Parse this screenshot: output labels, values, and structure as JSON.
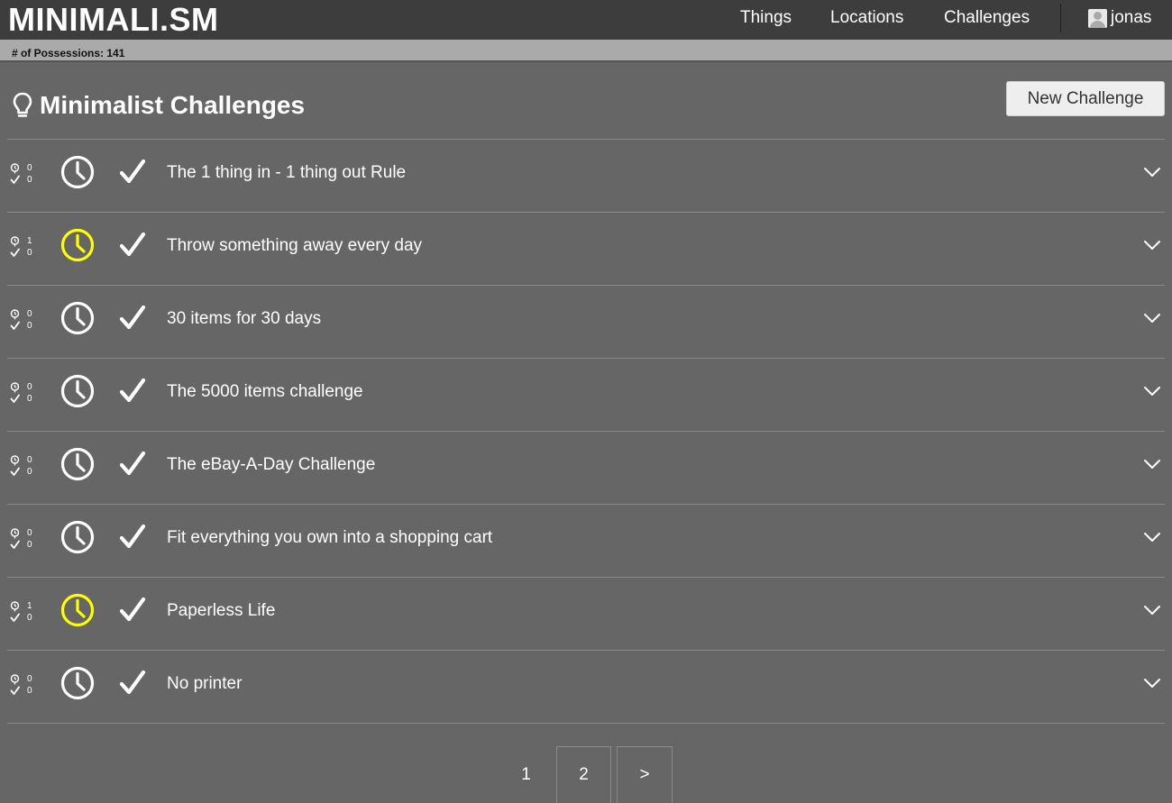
{
  "app": {
    "logo": "MINIMALI.SM",
    "nav": [
      "Things",
      "Locations",
      "Challenges"
    ],
    "user": "jonas",
    "possessions_label": "# of Possessions: 141"
  },
  "page": {
    "title": "Minimalist Challenges",
    "title_icon": "lightbulb-icon",
    "new_button": "New Challenge"
  },
  "colors": {
    "background": "#666666",
    "topbar": "#3d3d3d",
    "subbar": "#aaaaaa",
    "active_clock": "#ffff00",
    "inactive_clock": "#ffffff"
  },
  "challenges": [
    {
      "title": "The 1 thing in - 1 thing out Rule",
      "running": "0",
      "done": "0",
      "active": false
    },
    {
      "title": "Throw something away every day",
      "running": "1",
      "done": "0",
      "active": true
    },
    {
      "title": "30 items for 30 days",
      "running": "0",
      "done": "0",
      "active": false
    },
    {
      "title": "The 5000 items challenge",
      "running": "0",
      "done": "0",
      "active": false
    },
    {
      "title": "The eBay-A-Day Challenge",
      "running": "0",
      "done": "0",
      "active": false
    },
    {
      "title": "Fit everything you own into a shopping cart",
      "running": "0",
      "done": "0",
      "active": false
    },
    {
      "title": "Paperless Life",
      "running": "1",
      "done": "0",
      "active": true
    },
    {
      "title": "No printer",
      "running": "0",
      "done": "0",
      "active": false
    }
  ],
  "pagination": {
    "pages": [
      "1",
      "2"
    ],
    "next": ">",
    "current": "1"
  }
}
